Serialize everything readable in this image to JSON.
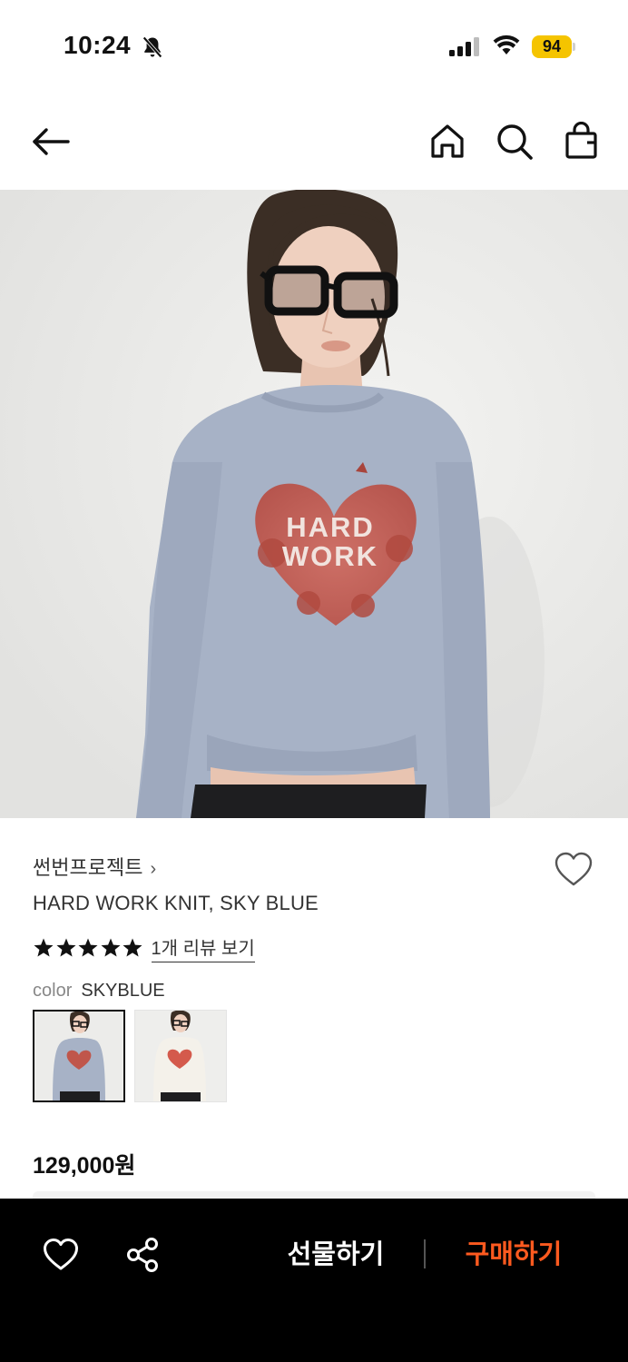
{
  "status": {
    "time": "10:24",
    "battery": "94",
    "icons": [
      "bell-slash-icon",
      "cellular-signal-icon",
      "wifi-icon",
      "battery-icon"
    ]
  },
  "header": {
    "icons": [
      "back-arrow-icon",
      "home-icon",
      "search-icon",
      "shopping-bag-icon"
    ]
  },
  "product": {
    "brand": "썬번프로젝트",
    "brand_chevron": "›",
    "name": "HARD WORK KNIT, SKY BLUE",
    "rating_stars": 5,
    "review_link": "1개 리뷰 보기",
    "color_label": "color",
    "color_value": "SKYBLUE",
    "swatches": [
      {
        "name": "SKYBLUE",
        "selected": true
      },
      {
        "name": "IVORY",
        "selected": false
      }
    ],
    "price": "129,000원",
    "graphic_text_line1": "HARD",
    "graphic_text_line2": "WORK"
  },
  "bottom_bar": {
    "gift_label": "선물하기",
    "buy_label": "구매하기"
  },
  "colors": {
    "accent_buy": "#ff5a1f",
    "sweater_blue": "#a7b2c6",
    "graphic_red": "#c0564b",
    "battery_yellow": "#f5c400"
  }
}
